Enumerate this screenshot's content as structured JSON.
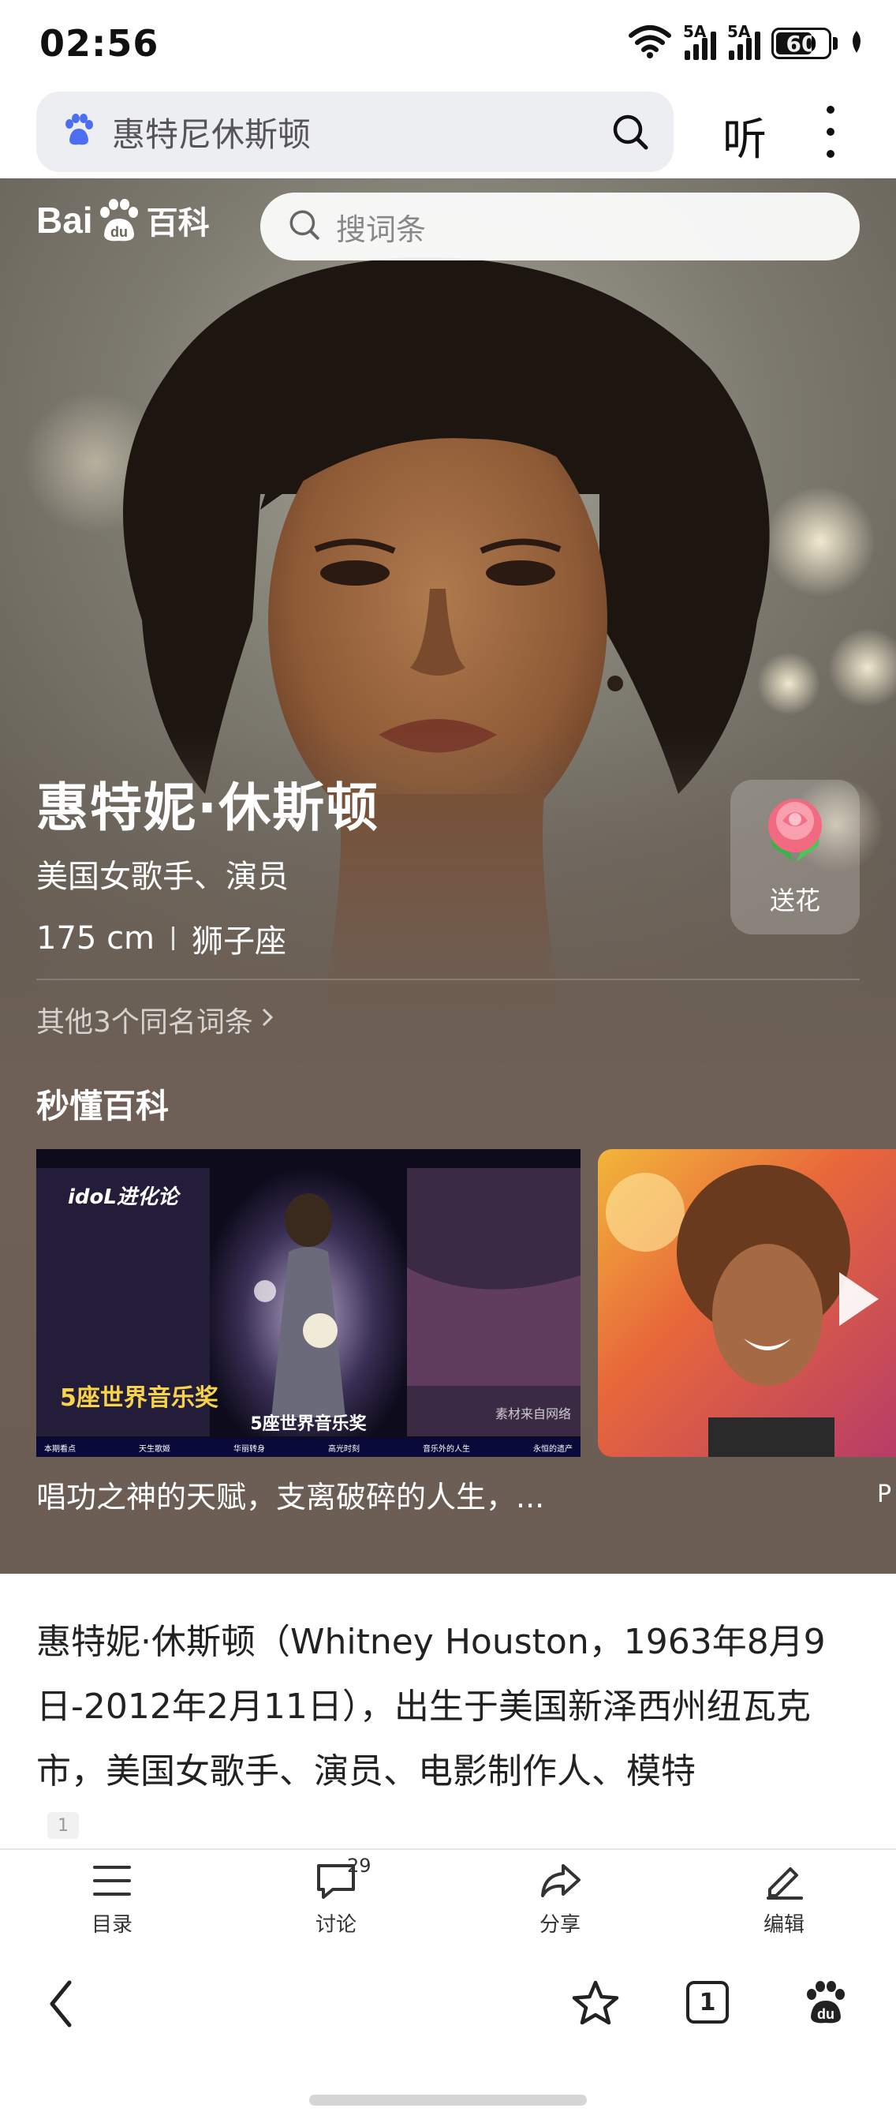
{
  "status_bar": {
    "time": "02:56",
    "signal1_label": "5A",
    "signal2_label": "5A",
    "battery": "60"
  },
  "browser": {
    "query": "惠特尼休斯顿",
    "listen_label": "听"
  },
  "header": {
    "logo_left": "Bai",
    "logo_paw": "du",
    "logo_right": "百科",
    "search_placeholder": "搜词条"
  },
  "hero": {
    "name": "惠特妮·休斯顿",
    "description": "美国女歌手、演员",
    "height": "175 cm",
    "zodiac": "狮子座",
    "other_entries": "其他3个同名词条",
    "flower_label": "送花"
  },
  "videos": {
    "section_title": "秒懂百科",
    "items": [
      {
        "caption": "唱功之神的天赋，支离破碎的人生，...",
        "overlay": "5座世界音乐奖",
        "subtitle": "5座世界音乐奖",
        "badge": "idoL进化论",
        "source": "素材来自网络",
        "chapters": [
          "本期看点",
          "天生歌姬",
          "华丽转身",
          "高光时刻",
          "音乐外的人生",
          "永恒的遗产"
        ]
      },
      {
        "caption": "P"
      }
    ]
  },
  "article": {
    "text": "惠特妮·休斯顿（Whitney Houston，1963年8月9日-2012年2月11日），出生于美国新泽西州纽瓦克市，美国女歌手、演员、电影制作人、模特",
    "citation": "1",
    "trailing": "。"
  },
  "toolbar": {
    "toc": "目录",
    "discuss": "讨论",
    "discuss_count": "29",
    "share": "分享",
    "edit": "编辑"
  },
  "nav": {
    "tab_count": "1"
  }
}
